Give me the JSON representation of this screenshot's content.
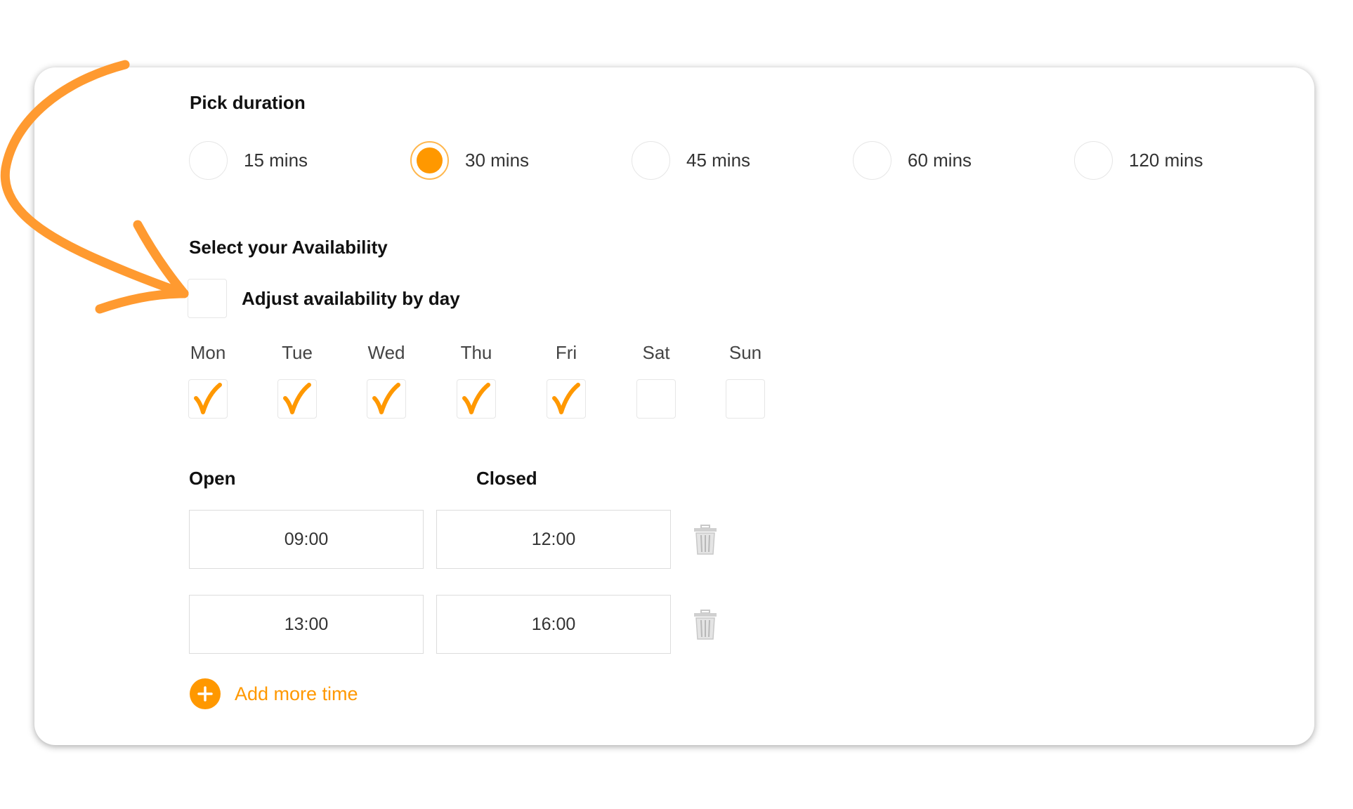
{
  "colors": {
    "accent": "#ff9800",
    "accent_light": "#ffb74d",
    "border": "#e6e6e6",
    "text": "#333333",
    "heading": "#111111"
  },
  "duration": {
    "title": "Pick duration",
    "options": [
      {
        "label": "15 mins",
        "selected": false
      },
      {
        "label": "30 mins",
        "selected": true
      },
      {
        "label": "45 mins",
        "selected": false
      },
      {
        "label": "60 mins",
        "selected": false
      },
      {
        "label": "120 mins",
        "selected": false
      }
    ]
  },
  "availability": {
    "title": "Select your Availability",
    "adjust_label": "Adjust availability by day",
    "adjust_checked": false,
    "days": [
      {
        "label": "Mon",
        "checked": true
      },
      {
        "label": "Tue",
        "checked": true
      },
      {
        "label": "Wed",
        "checked": true
      },
      {
        "label": "Thu",
        "checked": true
      },
      {
        "label": "Fri",
        "checked": true
      },
      {
        "label": "Sat",
        "checked": false
      },
      {
        "label": "Sun",
        "checked": false
      }
    ]
  },
  "times": {
    "open_label": "Open",
    "closed_label": "Closed",
    "rows": [
      {
        "open": "09:00",
        "closed": "12:00"
      },
      {
        "open": "13:00",
        "closed": "16:00"
      }
    ],
    "add_more_label": "Add more time"
  },
  "icons": {
    "trash": "trash-icon",
    "add": "plus-circle-icon",
    "check": "checkmark-icon",
    "arrow": "hand-drawn-arrow-icon"
  }
}
